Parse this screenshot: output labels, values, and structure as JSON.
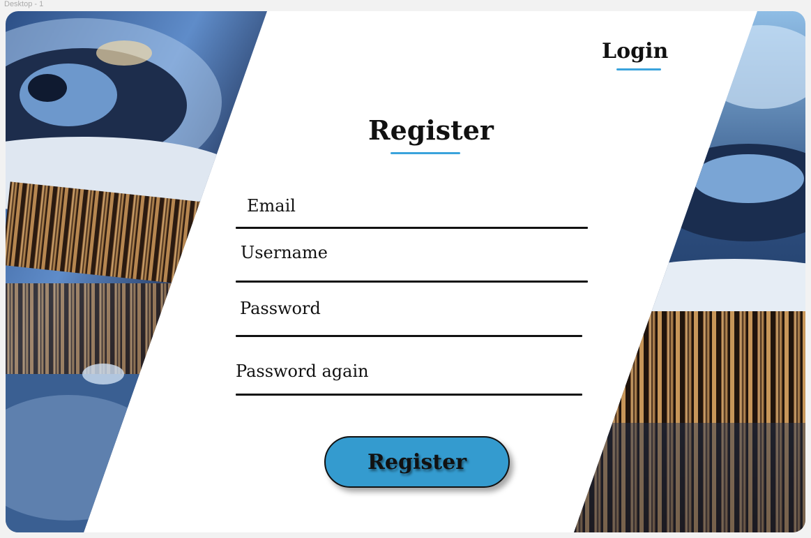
{
  "canvas": {
    "frame_label": "Desktop - 1"
  },
  "header": {
    "login_label": "Login"
  },
  "form": {
    "title": "Register",
    "fields": [
      {
        "label": "Email"
      },
      {
        "label": "Username"
      },
      {
        "label": "Password"
      },
      {
        "label": "Password again"
      }
    ],
    "submit_label": "Register"
  },
  "colors": {
    "accent_underline": "#3aa3dc",
    "button_fill": "#349bcf",
    "text": "#111111",
    "background": "#ffffff"
  },
  "icons": {
    "decor_left": "gear-machinery-photo",
    "decor_right": "gear-machinery-photo"
  }
}
